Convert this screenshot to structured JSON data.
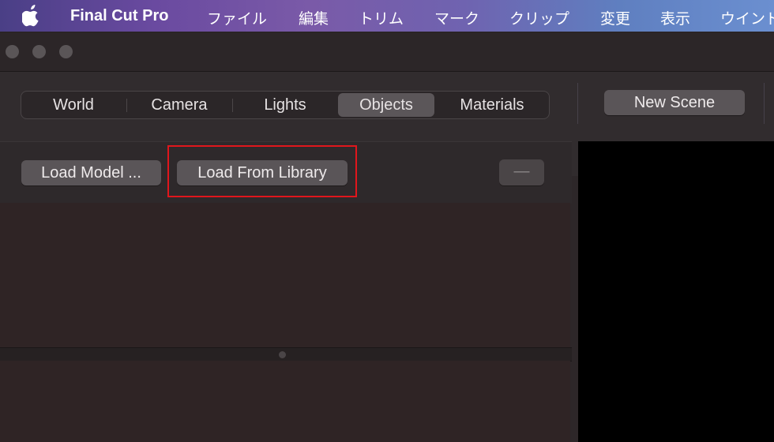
{
  "menubar": {
    "app_name": "Final Cut Pro",
    "items": [
      "ファイル",
      "編集",
      "トリム",
      "マーク",
      "クリップ",
      "変更",
      "表示",
      "ウインド"
    ]
  },
  "toolbar": {
    "tabs": [
      {
        "label": "World",
        "active": false
      },
      {
        "label": "Camera",
        "active": false
      },
      {
        "label": "Lights",
        "active": false
      },
      {
        "label": "Objects",
        "active": true
      },
      {
        "label": "Materials",
        "active": false
      }
    ],
    "new_scene_label": "New Scene"
  },
  "objects_panel": {
    "load_model_label": "Load Model ...",
    "load_library_label": "Load From Library",
    "remove_label": "—"
  },
  "colors": {
    "highlight": "#e0161c",
    "button_bg": "#5a5558",
    "viewport_bg": "#000000"
  }
}
